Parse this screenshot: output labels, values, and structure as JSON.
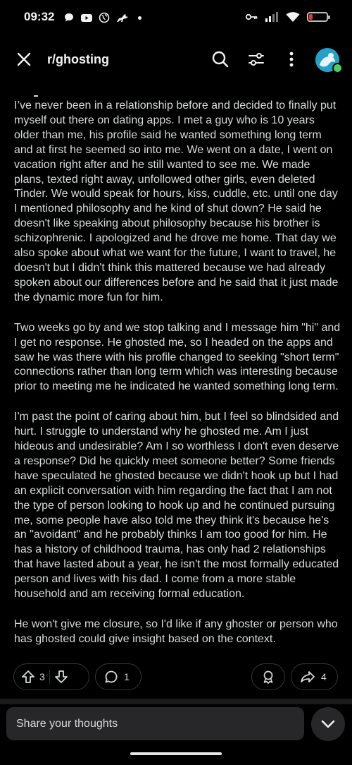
{
  "status_bar": {
    "time": "09:32",
    "battery_color": "#e03a2f"
  },
  "header": {
    "title": "r/ghosting",
    "icons": [
      "close-icon",
      "search-icon",
      "filter-icon",
      "more-icon",
      "avatar"
    ]
  },
  "post": {
    "paragraphs": [
      "I’ve never been in a relationship before and decided to finally put myself out there on dating apps. I met a guy who is 10 years older than me, his profile said he wanted something long term and at first he seemed so into me. We went on a date, I went on vacation right after and he still wanted to see me. We made plans, texted right away, unfollowed other girls, even deleted Tinder. We would speak for hours, kiss, cuddle, etc. until one day I mentioned philosophy and he kind of shut down? He said he doesn't like speaking about philosophy because his brother is schizophrenic. I apologized and he drove me home. That day we also spoke about what we want for the future, I want to travel, he doesn't but I didn't think this mattered because we had already spoken about our differences before and he said that it just made the dynamic more fun for him.",
      "Two weeks go by and we stop talking and I message him \"hi\" and I get no response. He ghosted me, so I headed on the apps and saw he was there with his profile changed to seeking \"short term\" connections rather than long term which was interesting because prior to meeting me he indicated he wanted something long term.",
      "I'm past the point of caring about him, but I feel so blindsided and hurt. I struggle to understand why he ghosted me. Am I just hideous and undesirable? Am I so worthless I don't even deserve a response? Did he quickly meet someone better? Some friends have speculated he ghosted because we didn't hook up but I had an explicit conversation with him regarding the fact that I am not the type of person looking to hook up and he continued pursuing me, some people have also told me they think it's because he's an \"avoidant\" and he probably thinks I am too good for him. He has a history of childhood trauma, has only had 2 relationships that have lasted about a year, he isn't the most formally educated person and lives with his dad. I come from a more stable household and am receiving formal education.",
      "He won't give me closure, so I'd like if any ghoster or person who has ghosted could give insight based on the context."
    ]
  },
  "actions": {
    "upvotes": "3",
    "comments": "1",
    "shares": "4"
  },
  "comment_bar": {
    "placeholder": "Share your thoughts"
  },
  "colors": {
    "background": "#000000",
    "text": "#d7dadc",
    "pill_border": "#343536",
    "input_bg": "#272729",
    "avatar": "#24a0c9",
    "online": "#46d160"
  }
}
